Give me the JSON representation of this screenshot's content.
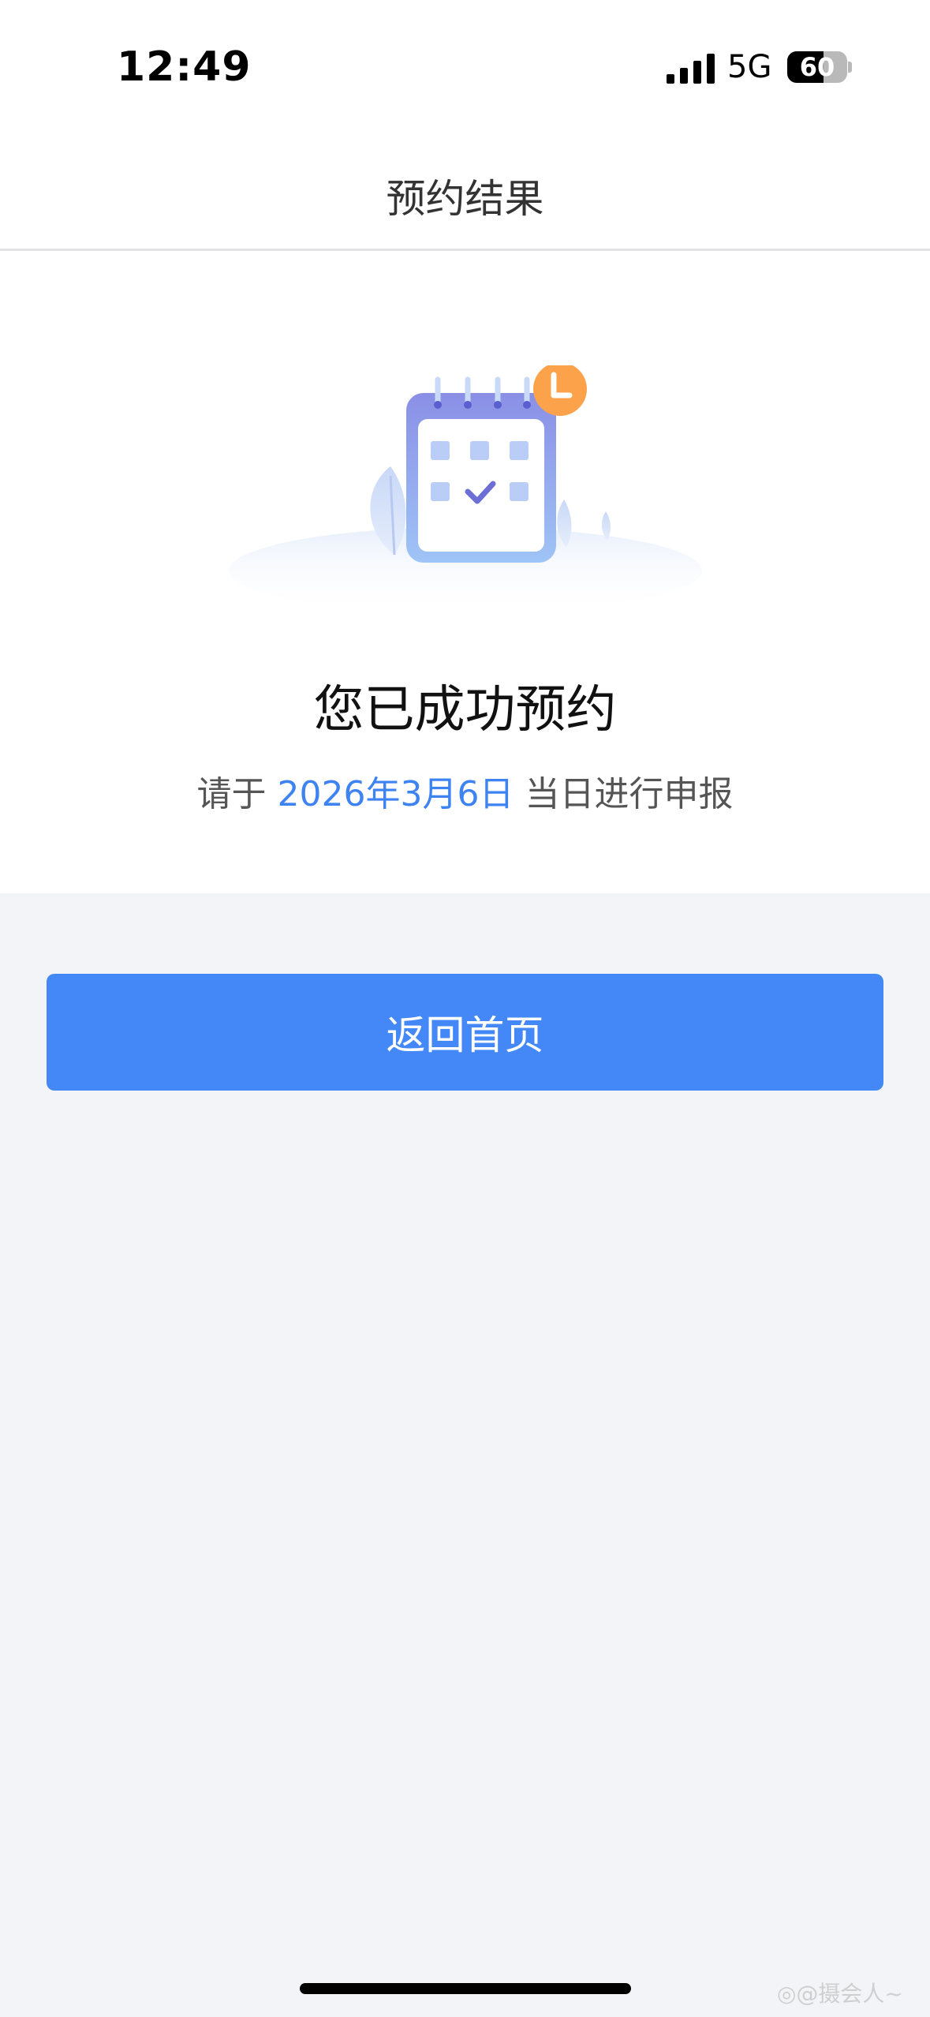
{
  "status_bar": {
    "time": "12:49",
    "network": "5G",
    "battery_level": "60",
    "battery_fraction": 0.6,
    "signal_bars": 4
  },
  "nav": {
    "title": "预约结果"
  },
  "result": {
    "illustration": "calendar-check-clock-icon",
    "title": "您已成功预约",
    "sub_prefix": "请于 ",
    "date": "2026年3月6日",
    "sub_suffix": " 当日进行申报"
  },
  "actions": {
    "home_button_label": "返回首页"
  },
  "watermark": "◎@摄会人~",
  "colors": {
    "accent": "#4388f6",
    "date_text": "#3d83f2",
    "page_background": "#f3f4f8",
    "clock_badge": "#fba24a"
  }
}
